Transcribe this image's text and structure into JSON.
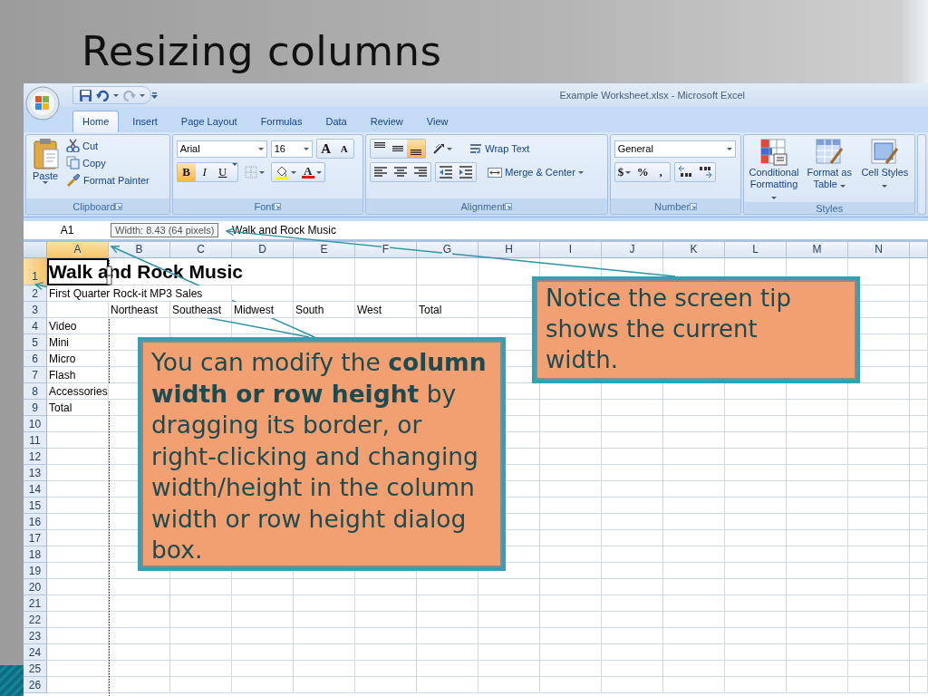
{
  "slide": {
    "title": "Resizing columns"
  },
  "window": {
    "title": "Example Worksheet.xlsx - Microsoft Excel"
  },
  "tabs": [
    {
      "label": "Home",
      "selected": true
    },
    {
      "label": "Insert",
      "selected": false
    },
    {
      "label": "Page Layout",
      "selected": false
    },
    {
      "label": "Formulas",
      "selected": false
    },
    {
      "label": "Data",
      "selected": false
    },
    {
      "label": "Review",
      "selected": false
    },
    {
      "label": "View",
      "selected": false
    }
  ],
  "clipboard": {
    "label": "Clipboard",
    "paste": "Paste",
    "cut": "Cut",
    "copy": "Copy",
    "format_painter": "Format Painter"
  },
  "font": {
    "label": "Font",
    "name": "Arial",
    "size": "16",
    "grow": "A",
    "shrink": "A",
    "font_color": "A",
    "format_buttons": [
      {
        "label": "B",
        "kind": "bold",
        "selected": true
      },
      {
        "label": "I",
        "kind": "italic",
        "selected": false
      },
      {
        "label": "U",
        "kind": "underline",
        "selected": false
      }
    ]
  },
  "alignment": {
    "label": "Alignment",
    "wrap_text": "Wrap Text",
    "merge_center": "Merge & Center",
    "vertical": [
      {
        "kind": "top",
        "selected": false
      },
      {
        "kind": "middle",
        "selected": false
      },
      {
        "kind": "bottom",
        "selected": true
      }
    ]
  },
  "number": {
    "label": "Number",
    "format": "General",
    "currency": "$",
    "percent": "%",
    "comma": ","
  },
  "styles": {
    "label": "Styles",
    "buttons": [
      {
        "kind": "conditional",
        "label": "Conditional Formatting"
      },
      {
        "kind": "table",
        "label": "Format as Table"
      },
      {
        "kind": "cell",
        "label": "Cell Styles"
      }
    ]
  },
  "formula_bar": {
    "name_box": "A1",
    "content": "Walk and Rock Music"
  },
  "screen_tip": "Width: 8.43 (64 pixels)",
  "sheet": {
    "columns": [
      {
        "label": "A",
        "selected": true
      },
      {
        "label": "B",
        "selected": false
      },
      {
        "label": "C",
        "selected": false
      },
      {
        "label": "D",
        "selected": false
      },
      {
        "label": "E",
        "selected": false
      },
      {
        "label": "F",
        "selected": false
      },
      {
        "label": "G",
        "selected": false
      },
      {
        "label": "H",
        "selected": false
      },
      {
        "label": "I",
        "selected": false
      },
      {
        "label": "J",
        "selected": false
      },
      {
        "label": "K",
        "selected": false
      },
      {
        "label": "L",
        "selected": false
      },
      {
        "label": "M",
        "selected": false
      },
      {
        "label": "N",
        "selected": false
      }
    ],
    "rows": [
      {
        "label": "1",
        "selected": true,
        "kind": "title",
        "cells": [
          "Walk and Rock Music"
        ]
      },
      {
        "label": "2",
        "selected": false,
        "kind": "normal",
        "cells": [
          "First Quarter Rock-it MP3 Sales"
        ]
      },
      {
        "label": "3",
        "selected": false,
        "kind": "normal",
        "cells": [
          null,
          "Northeast",
          "Southeast",
          "Midwest",
          "South",
          "West",
          "Total"
        ]
      },
      {
        "label": "4",
        "selected": false,
        "kind": "normal",
        "cells": [
          "Video"
        ]
      },
      {
        "label": "5",
        "selected": false,
        "kind": "normal",
        "cells": [
          "Mini"
        ]
      },
      {
        "label": "6",
        "selected": false,
        "kind": "normal",
        "cells": [
          "Micro"
        ]
      },
      {
        "label": "7",
        "selected": false,
        "kind": "normal",
        "cells": [
          "Flash"
        ]
      },
      {
        "label": "8",
        "selected": false,
        "kind": "normal",
        "cells": [
          "Accessories"
        ]
      },
      {
        "label": "9",
        "selected": false,
        "kind": "normal",
        "cells": [
          "Total"
        ]
      },
      {
        "label": "10",
        "selected": false,
        "kind": "normal"
      },
      {
        "label": "11",
        "selected": false,
        "kind": "normal"
      },
      {
        "label": "12",
        "selected": false,
        "kind": "normal"
      },
      {
        "label": "13",
        "selected": false,
        "kind": "normal"
      },
      {
        "label": "14",
        "selected": false,
        "kind": "normal"
      },
      {
        "label": "15",
        "selected": false,
        "kind": "normal"
      },
      {
        "label": "16",
        "selected": false,
        "kind": "normal"
      },
      {
        "label": "17",
        "selected": false,
        "kind": "normal"
      },
      {
        "label": "18",
        "selected": false,
        "kind": "normal"
      },
      {
        "label": "19",
        "selected": false,
        "kind": "normal"
      },
      {
        "label": "20",
        "selected": false,
        "kind": "normal"
      },
      {
        "label": "21",
        "selected": false,
        "kind": "normal"
      },
      {
        "label": "22",
        "selected": false,
        "kind": "normal"
      },
      {
        "label": "23",
        "selected": false,
        "kind": "normal"
      },
      {
        "label": "24",
        "selected": false,
        "kind": "normal"
      },
      {
        "label": "25",
        "selected": false,
        "kind": "normal"
      },
      {
        "label": "26",
        "selected": false,
        "kind": "normal"
      }
    ]
  },
  "callouts": [
    {
      "text": "You can modify the **column width or row height** by dragging its border, or right-clicking and changing width/height in the column width or row height dialog box."
    },
    {
      "text": "Notice the screen tip shows the current width."
    }
  ]
}
